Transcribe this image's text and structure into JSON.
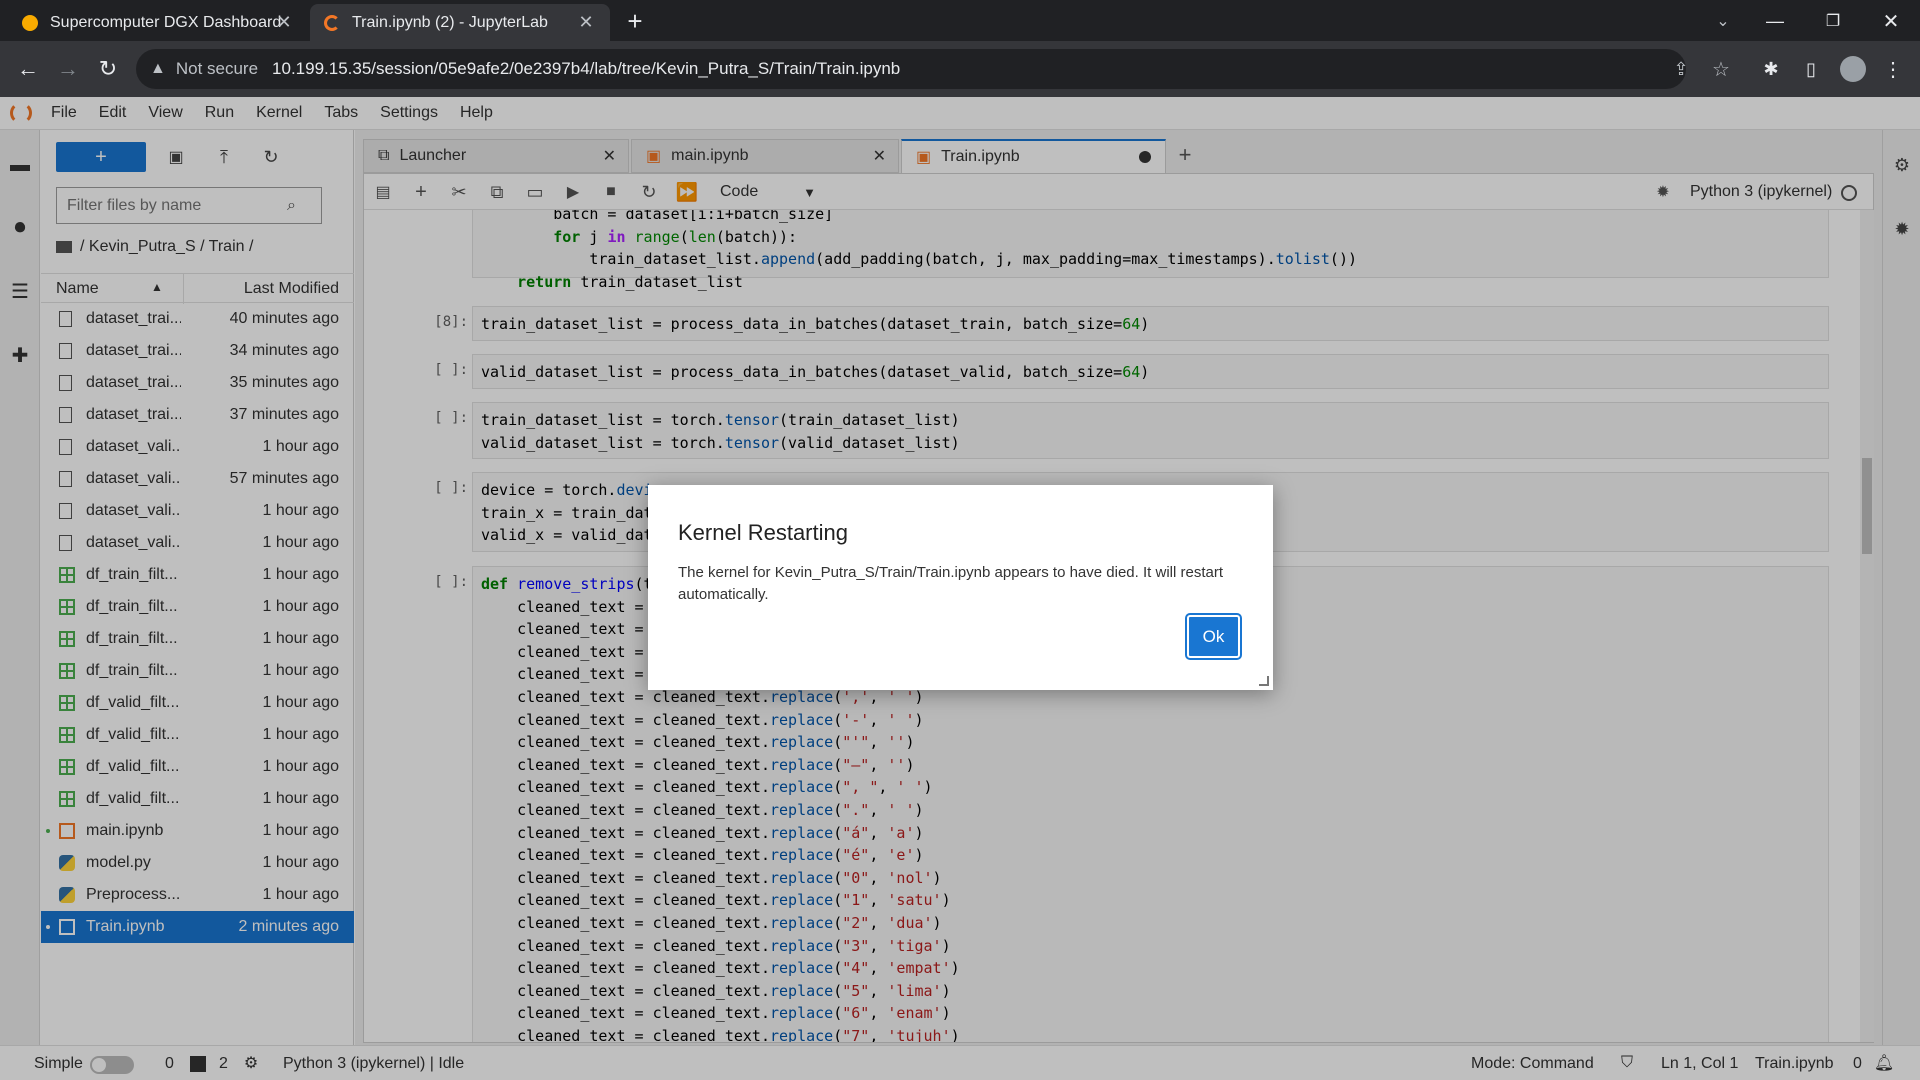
{
  "browser": {
    "tabs": [
      {
        "title": "Supercomputer DGX Dashboard",
        "active": false
      },
      {
        "title": "Train.ipynb (2) - JupyterLab",
        "active": true
      }
    ],
    "security_label": "Not secure",
    "url": "10.199.15.35/session/05e9afe2/0e2397b4/lab/tree/Kevin_Putra_S/Train/Train.ipynb"
  },
  "menubar": [
    "File",
    "Edit",
    "View",
    "Run",
    "Kernel",
    "Tabs",
    "Settings",
    "Help"
  ],
  "filebrowser": {
    "filter_placeholder": "Filter files by name",
    "breadcrumb": "/ Kevin_Putra_S / Train /",
    "col_name": "Name",
    "col_modified": "Last Modified",
    "files": [
      {
        "name": "dataset_trai...",
        "modified": "40 minutes ago",
        "icon": "file-icon"
      },
      {
        "name": "dataset_trai...",
        "modified": "34 minutes ago",
        "icon": "file-icon"
      },
      {
        "name": "dataset_trai...",
        "modified": "35 minutes ago",
        "icon": "file-icon"
      },
      {
        "name": "dataset_trai...",
        "modified": "37 minutes ago",
        "icon": "file-icon"
      },
      {
        "name": "dataset_vali...",
        "modified": "1 hour ago",
        "icon": "file-icon"
      },
      {
        "name": "dataset_vali...",
        "modified": "57 minutes ago",
        "icon": "file-icon"
      },
      {
        "name": "dataset_vali...",
        "modified": "1 hour ago",
        "icon": "file-icon"
      },
      {
        "name": "dataset_vali...",
        "modified": "1 hour ago",
        "icon": "file-icon"
      },
      {
        "name": "df_train_filt...",
        "modified": "1 hour ago",
        "icon": "spreadsheet-icon"
      },
      {
        "name": "df_train_filt...",
        "modified": "1 hour ago",
        "icon": "spreadsheet-icon"
      },
      {
        "name": "df_train_filt...",
        "modified": "1 hour ago",
        "icon": "spreadsheet-icon"
      },
      {
        "name": "df_train_filt...",
        "modified": "1 hour ago",
        "icon": "spreadsheet-icon"
      },
      {
        "name": "df_valid_filt...",
        "modified": "1 hour ago",
        "icon": "spreadsheet-icon"
      },
      {
        "name": "df_valid_filt...",
        "modified": "1 hour ago",
        "icon": "spreadsheet-icon"
      },
      {
        "name": "df_valid_filt...",
        "modified": "1 hour ago",
        "icon": "spreadsheet-icon"
      },
      {
        "name": "df_valid_filt...",
        "modified": "1 hour ago",
        "icon": "spreadsheet-icon"
      },
      {
        "name": "main.ipynb",
        "modified": "1 hour ago",
        "icon": "notebook-icon"
      },
      {
        "name": "model.py",
        "modified": "1 hour ago",
        "icon": "python-icon"
      },
      {
        "name": "Preprocess...",
        "modified": "1 hour ago",
        "icon": "python-icon"
      },
      {
        "name": "Train.ipynb",
        "modified": "2 minutes ago",
        "icon": "notebook-icon"
      }
    ]
  },
  "notebook_tabs": [
    "Launcher",
    "main.ipynb",
    "Train.ipynb"
  ],
  "toolbar": {
    "cell_type": "Code",
    "kernel": "Python 3 (ipykernel)"
  },
  "prompts": [
    "[8]:",
    "[ ]:",
    "[ ]:",
    "[ ]:",
    "[ ]:"
  ],
  "dialog": {
    "title": "Kernel Restarting",
    "body": "The kernel for Kevin_Putra_S/Train/Train.ipynb appears to have died. It will restart automatically.",
    "ok": "Ok"
  },
  "statusbar": {
    "simple": "Simple",
    "count_a": "0",
    "count_b": "2",
    "kernel_status": "Python 3 (ipykernel) | Idle",
    "mode": "Mode: Command",
    "cursor": "Ln 1, Col 1",
    "file": "Train.ipynb",
    "notifications": "0"
  },
  "colors": {
    "accent": "#1976d2",
    "chrome_dark": "#202124",
    "chrome_mid": "#35363a",
    "unsaved_dot": "#333333"
  }
}
